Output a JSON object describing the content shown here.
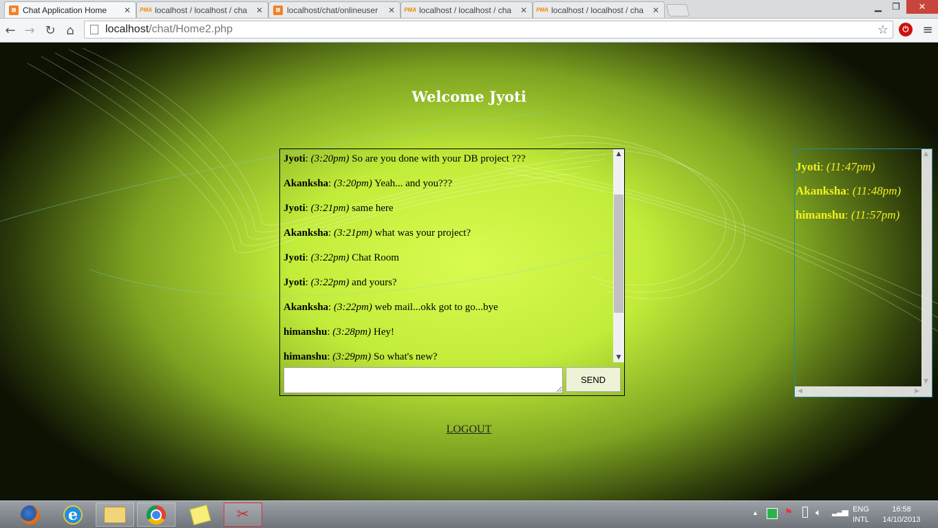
{
  "browser": {
    "tabs": [
      {
        "title": "Chat Application Home",
        "icon": "xampp-icon",
        "active": true
      },
      {
        "title": "localhost / localhost / cha",
        "icon": "phpmyadmin-icon",
        "active": false
      },
      {
        "title": "localhost/chat/onlineuser",
        "icon": "xampp-icon",
        "active": false
      },
      {
        "title": "localhost / localhost / cha",
        "icon": "phpmyadmin-icon",
        "active": false
      },
      {
        "title": "localhost / localhost / cha",
        "icon": "phpmyadmin-icon",
        "active": false
      }
    ],
    "url_host": "localhost",
    "url_path": "/chat/Home2.php"
  },
  "page": {
    "welcome": "Welcome Jyoti",
    "messages": [
      {
        "user": "Jyoti",
        "time": "(3:20pm)",
        "text": "So are you done with your DB project ???"
      },
      {
        "user": "Akanksha",
        "time": "(3:20pm)",
        "text": "Yeah... and you???"
      },
      {
        "user": "Jyoti",
        "time": "(3:21pm)",
        "text": "same here"
      },
      {
        "user": "Akanksha",
        "time": "(3:21pm)",
        "text": "what was your project?"
      },
      {
        "user": "Jyoti",
        "time": "(3:22pm)",
        "text": "Chat Room"
      },
      {
        "user": "Jyoti",
        "time": "(3:22pm)",
        "text": "and yours?"
      },
      {
        "user": "Akanksha",
        "time": "(3:22pm)",
        "text": "web mail...okk got to go...bye"
      },
      {
        "user": "himanshu",
        "time": "(3:28pm)",
        "text": "Hey!"
      },
      {
        "user": "himanshu",
        "time": "(3:29pm)",
        "text": "So what's new?"
      }
    ],
    "message_input_value": "",
    "send_label": "SEND",
    "logout_label": "LOGOUT",
    "online_users": [
      {
        "user": "Jyoti",
        "time": "(11:47pm)"
      },
      {
        "user": "Akanksha",
        "time": "(11:48pm)"
      },
      {
        "user": "himanshu",
        "time": "(11:57pm)"
      }
    ],
    "colors": {
      "background": "#c8f03c",
      "online_text": "#f3f020"
    }
  },
  "taskbar": {
    "apps": [
      "firefox-icon",
      "internet-explorer-icon",
      "file-explorer-icon",
      "chrome-icon",
      "sticky-notes-icon",
      "snipping-tool-icon"
    ],
    "language_line1": "ENG",
    "language_line2": "INTL",
    "time": "16:58",
    "date": "14/10/2013"
  }
}
